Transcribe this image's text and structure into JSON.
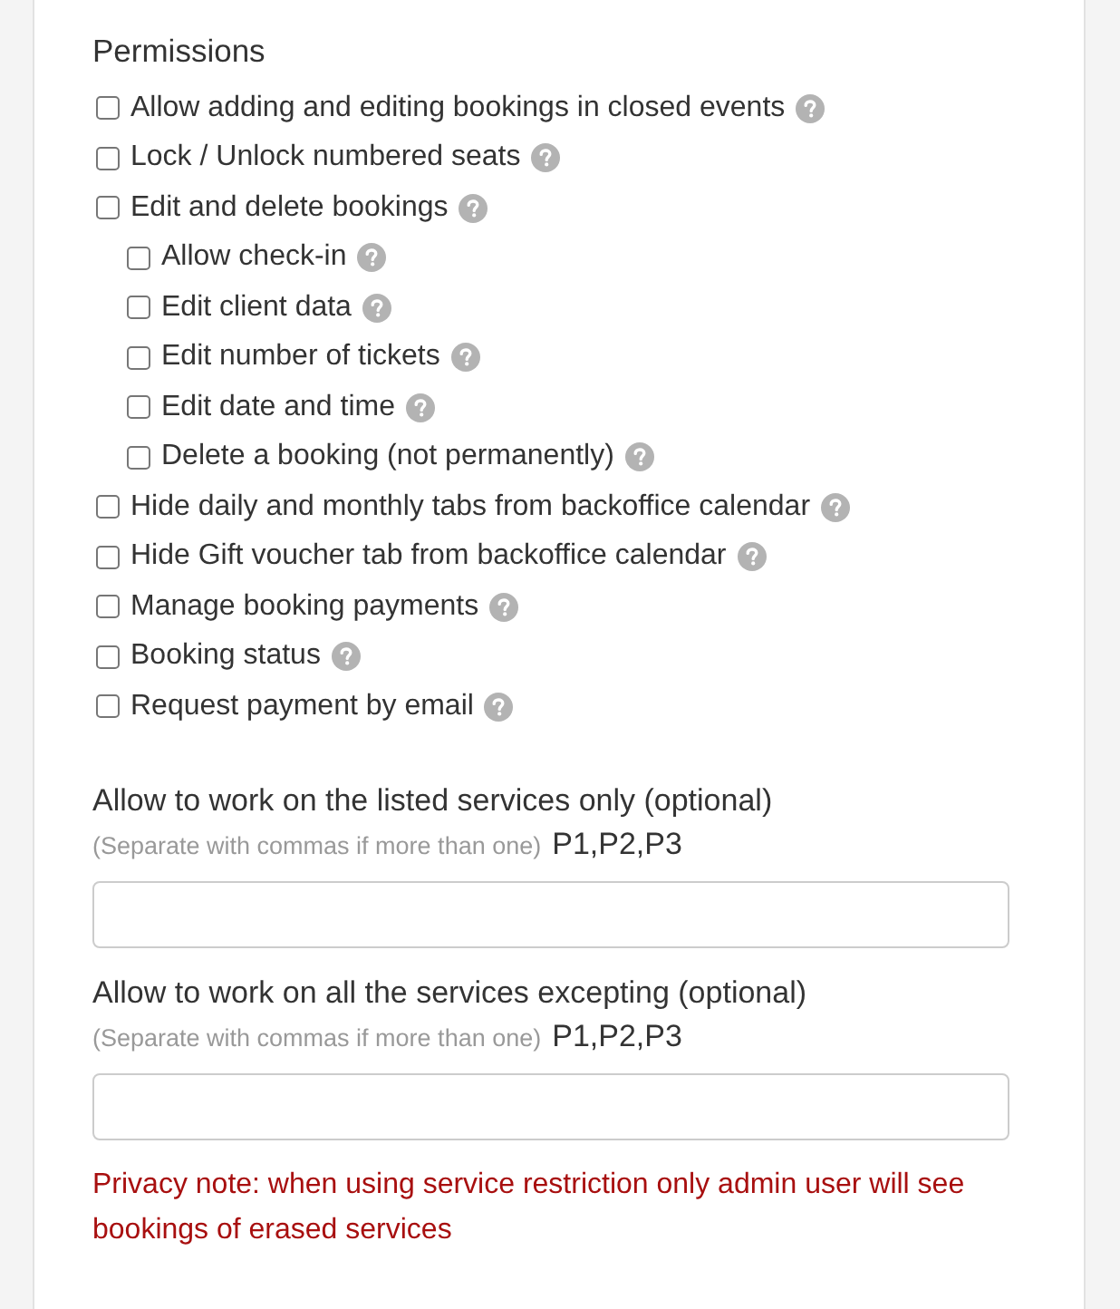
{
  "heading": "Permissions",
  "permissions": [
    {
      "label": "Allow adding and editing bookings in closed events",
      "checked": false
    },
    {
      "label": "Lock / Unlock numbered seats",
      "checked": false
    },
    {
      "label": "Edit and delete bookings",
      "checked": false,
      "children": [
        {
          "label": "Allow check-in",
          "checked": false
        },
        {
          "label": "Edit client data",
          "checked": false
        },
        {
          "label": "Edit number of tickets",
          "checked": false
        },
        {
          "label": "Edit date and time",
          "checked": false
        },
        {
          "label": "Delete a booking (not permanently)",
          "checked": false
        }
      ]
    },
    {
      "label": "Hide daily and monthly tabs from backoffice calendar",
      "checked": false
    },
    {
      "label": "Hide Gift voucher tab from backoffice calendar",
      "checked": false
    },
    {
      "label": "Manage booking payments",
      "checked": false
    },
    {
      "label": "Booking status",
      "checked": false
    },
    {
      "label": "Request payment by email",
      "checked": false
    }
  ],
  "service_filters": [
    {
      "label": "Allow to work on the listed services only (optional)",
      "hint": "(Separate with commas if more than one)",
      "example": "P1,P2,P3"
    },
    {
      "label": "Allow to work on all the services excepting (optional)",
      "hint": "(Separate with commas if more than one)",
      "example": "P1,P2,P3"
    }
  ],
  "privacy_note": "Privacy note: when using service restriction only admin user will see bookings of erased services"
}
